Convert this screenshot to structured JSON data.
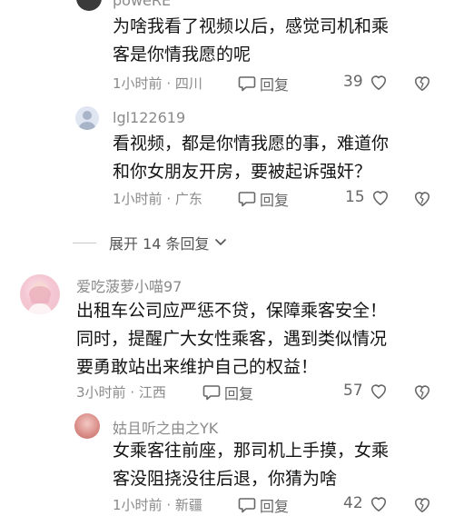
{
  "comments": [
    {
      "username": "poweRE",
      "lines": [
        "为啥我看了视频以后，感觉司机和乘",
        "客是你情我愿的呢"
      ],
      "time": "1小时前",
      "location": "四川",
      "reply_label": "回复",
      "likes": "39"
    },
    {
      "username": "lgl122619",
      "lines": [
        "看视频，都是你情我愿的事，难道你",
        "和你女朋友开房，要被起诉强奸？"
      ],
      "time": "1小时前",
      "location": "广东",
      "reply_label": "回复",
      "likes": "15"
    },
    {
      "username": "爱吃菠萝小喵97",
      "lines": [
        "出租车公司应严惩不贷，保障乘客安全！",
        "同时，提醒广大女性乘客，遇到类似情况",
        "要勇敢站出来维护自己的权益！"
      ],
      "time": "3小时前",
      "location": "江西",
      "reply_label": "回复",
      "likes": "57"
    },
    {
      "username": "姑且听之由之YK",
      "lines": [
        "女乘客往前座，那司机上手摸，女乘",
        "客没阻挠没往后退，你猜为啥"
      ],
      "time": "1小时前",
      "location": "新疆",
      "reply_label": "回复",
      "likes": "42"
    }
  ],
  "expand_replies": "展开 14 条回复",
  "separator": "·",
  "icons": [
    "reply-bubble-icon",
    "heart-icon",
    "broken-heart-icon",
    "chevron-down-icon"
  ]
}
